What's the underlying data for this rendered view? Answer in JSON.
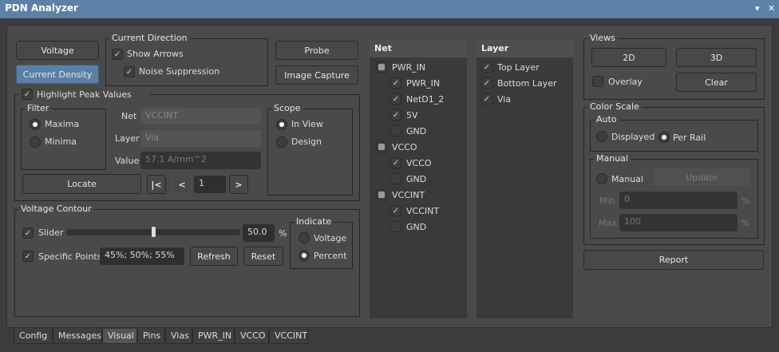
{
  "title": "PDN Analyzer",
  "mode_buttons": {
    "voltage": "Voltage",
    "current_density": "Current Density"
  },
  "current_direction": {
    "legend": "Current Direction",
    "show_arrows": "Show Arrows",
    "noise_suppression": "Noise Suppression"
  },
  "actions": {
    "probe": "Probe",
    "image_capture": "Image Capture"
  },
  "highlight": {
    "label": "Highlight Peak Values",
    "filter": {
      "legend": "Filter",
      "maxima": "Maxima",
      "minima": "Minima"
    },
    "net_label": "Net",
    "net_value": "VCCINT",
    "layer_label": "Layer",
    "layer_value": "Via",
    "value_label": "Value",
    "value_value": "57.1 A/mm^2",
    "scope": {
      "legend": "Scope",
      "in_view": "In View",
      "design": "Design"
    },
    "locate": "Locate",
    "first": "|<",
    "prev": "<",
    "page": "1",
    "next": ">"
  },
  "contour": {
    "legend": "Voltage Contour",
    "slider_label": "Slider",
    "slider_value": "50.0",
    "slider_fraction": 0.5,
    "percent": "%",
    "specific_label": "Specific Points",
    "specific_value": "45%; 50%; 55%",
    "refresh": "Refresh",
    "reset": "Reset",
    "indicate": {
      "legend": "Indicate",
      "voltage": "Voltage",
      "percent": "Percent"
    }
  },
  "net_list": {
    "header": "Net",
    "items": [
      {
        "label": "PWR_IN",
        "level": 0,
        "state": "partial"
      },
      {
        "label": "PWR_IN",
        "level": 1,
        "state": "checked"
      },
      {
        "label": "NetD1_2",
        "level": 1,
        "state": "checked"
      },
      {
        "label": "5V",
        "level": 1,
        "state": "checked"
      },
      {
        "label": "GND",
        "level": 1,
        "state": "unchecked"
      },
      {
        "label": "VCCO",
        "level": 0,
        "state": "partial"
      },
      {
        "label": "VCCO",
        "level": 1,
        "state": "checked"
      },
      {
        "label": "GND",
        "level": 1,
        "state": "unchecked"
      },
      {
        "label": "VCCINT",
        "level": 0,
        "state": "partial"
      },
      {
        "label": "VCCINT",
        "level": 1,
        "state": "checked"
      },
      {
        "label": "GND",
        "level": 1,
        "state": "unchecked"
      }
    ]
  },
  "layer_list": {
    "header": "Layer",
    "items": [
      {
        "label": "Top Layer",
        "state": "checked"
      },
      {
        "label": "Bottom Layer",
        "state": "checked"
      },
      {
        "label": "Via",
        "state": "checked"
      }
    ]
  },
  "views": {
    "legend": "Views",
    "b2d": "2D",
    "b3d": "3D",
    "overlay": "Overlay",
    "clear": "Clear"
  },
  "color_scale": {
    "legend": "Color Scale",
    "auto": "Auto",
    "displayed": "Displayed",
    "per_rail": "Per Rail",
    "manual_legend": "Manual",
    "manual": "Manual",
    "update": "Update",
    "min_label": "Min",
    "min_value": "0",
    "max_label": "Max",
    "max_value": "100",
    "pct": "%"
  },
  "report": "Report",
  "tabs": [
    "Config",
    "Messages",
    "Visual",
    "Pins",
    "Vias",
    "PWR_IN",
    "VCCO",
    "VCCINT"
  ],
  "active_tab": "Visual"
}
